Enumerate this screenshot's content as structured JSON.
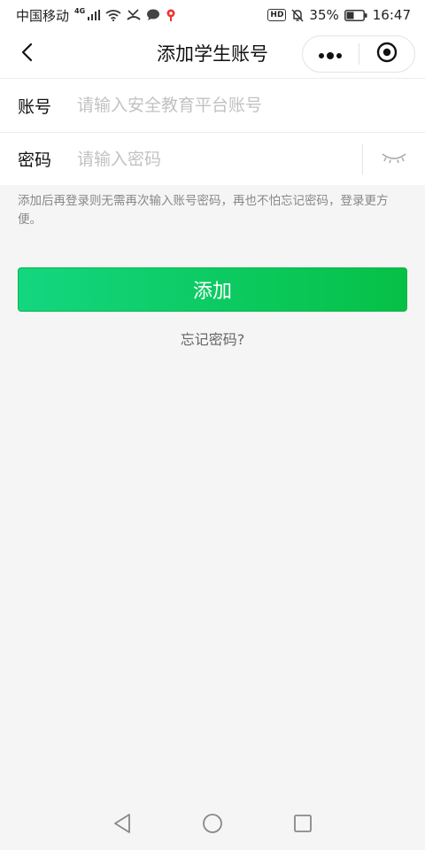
{
  "status_bar": {
    "carrier": "中国移动",
    "network": "4G",
    "battery": "35%",
    "time": "16:47",
    "hd": "HD"
  },
  "nav": {
    "title": "添加学生账号",
    "back_icon": "chevron-left-icon",
    "more_icon": "more-dots-icon",
    "close_icon": "target-icon"
  },
  "form": {
    "account_label": "账号",
    "account_placeholder": "请输入安全教育平台账号",
    "account_value": "",
    "password_label": "密码",
    "password_placeholder": "请输入密码",
    "password_value": "",
    "eye_icon": "eye-closed-icon"
  },
  "hint": "添加后再登录则无需再次输入账号密码，再也不怕忘记密码，登录更方便。",
  "add_label": "添加",
  "forgot_label": "忘记密码?",
  "colors": {
    "primary": "#07c160",
    "primary_light": "#13d680",
    "placeholder": "#c2c2c2",
    "hint": "#888888",
    "background": "#f5f5f5"
  }
}
